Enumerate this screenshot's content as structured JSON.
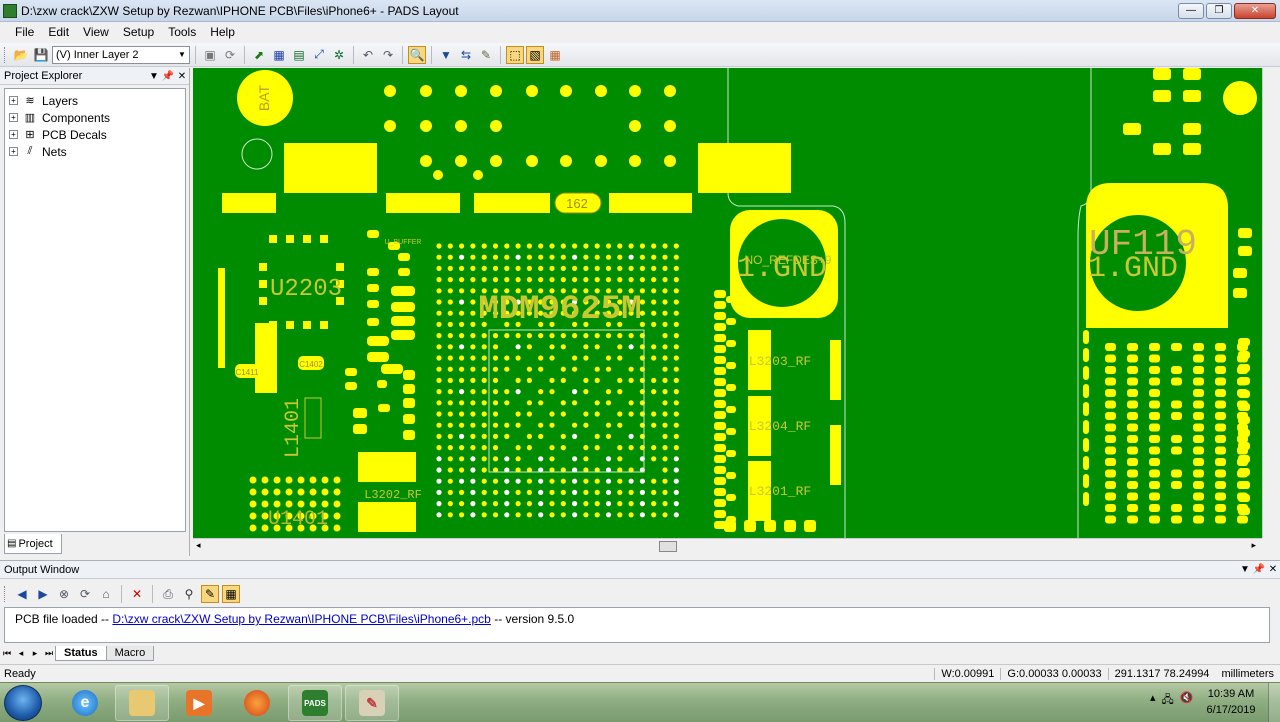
{
  "window": {
    "title": "D:\\zxw crack\\ZXW Setup by Rezwan\\IPHONE PCB\\Files\\iPhone6+ - PADS Layout",
    "minimize": "—",
    "maximize": "❐",
    "close": "✕"
  },
  "menu": {
    "items": [
      "File",
      "Edit",
      "View",
      "Setup",
      "Tools",
      "Help"
    ]
  },
  "toolbar": {
    "layer_select": "(V) Inner Layer 2",
    "icons": [
      "open-icon",
      "save-icon",
      "layer-select",
      "properties-icon",
      "refresh-icon",
      "route-icon",
      "pads-icon",
      "board-icon",
      "connect-icon",
      "snap-icon",
      "undo-icon",
      "redo-icon",
      "zoom-icon",
      "display-icon",
      "flip-icon",
      "brush-icon",
      "select-mode-icon",
      "view-mode-icon",
      "grid-icon"
    ],
    "zoom_active": true
  },
  "explorer": {
    "title": "Project Explorer",
    "items": [
      {
        "label": "Layers",
        "icon": "layers-icon"
      },
      {
        "label": "Components",
        "icon": "components-icon"
      },
      {
        "label": "PCB Decals",
        "icon": "pcb-decals-icon"
      },
      {
        "label": "Nets",
        "icon": "nets-icon"
      }
    ],
    "tab": "Project"
  },
  "pcb": {
    "background_color": "#008c00",
    "copper_color": "#ffff00",
    "labels": {
      "chip": "MDM9625M",
      "u2203": "U2203",
      "u1401": "U1401",
      "l1401": "L1401",
      "l3202": "L3202_RF",
      "l3203": "L3203_RF",
      "l3204": "L3204_RF",
      "l3201": "L3201_RF",
      "gnd_left": "1.GND",
      "gnd_right": "1.GND",
      "uf119": "UF119",
      "no_refdes": "NO_REFDES+9",
      "c1411": "C1411",
      "c1402": "C1402",
      "tag_162": "162",
      "bat": "BAT",
      "u_buffer": "U_BUFFER"
    }
  },
  "output": {
    "title": "Output Window",
    "message_prefix": "PCB file loaded -- ",
    "message_path": "D:\\zxw crack\\ZXW Setup by Rezwan\\IPHONE PCB\\Files\\iPhone6+.pcb",
    "message_suffix": " -- version 9.5.0",
    "tabs": [
      "Status",
      "Macro"
    ],
    "active_tab": "Status"
  },
  "status": {
    "ready": "Ready",
    "width": "W:0.00991",
    "grid": "G:0.00033 0.00033",
    "coords": "291.1317   78.24994",
    "units": "millimeters"
  },
  "taskbar": {
    "time": "10:39 AM",
    "date": "6/17/2019",
    "apps": [
      "internet-explorer-icon",
      "file-explorer-icon",
      "media-player-icon",
      "firefox-icon",
      "pads-app-icon",
      "paint-icon"
    ],
    "pads_label": "PADS"
  }
}
